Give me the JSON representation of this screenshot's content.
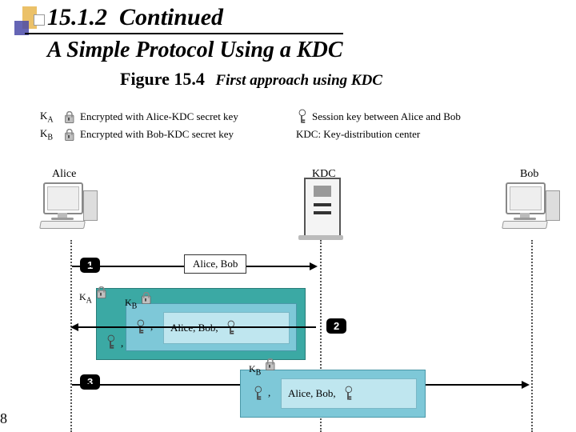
{
  "header": {
    "section_no": "15.1.2",
    "cont": "Continued",
    "subtitle": "A Simple Protocol Using a KDC"
  },
  "figure": {
    "num": "Figure 15.4",
    "title": "First approach using KDC"
  },
  "legend": {
    "ka_sym": "K",
    "ka_sub": "A",
    "ka_text": "Encrypted with Alice-KDC secret key",
    "kb_sym": "K",
    "kb_sub": "B",
    "kb_text": "Encrypted with Bob-KDC secret key",
    "skey_text": "Session key between Alice and Bob",
    "kdc_text": "KDC: Key-distribution center"
  },
  "actors": {
    "alice": "Alice",
    "kdc": "KDC",
    "bob": "Bob"
  },
  "steps": {
    "s1": "1",
    "s2": "2",
    "s3": "3"
  },
  "msgs": {
    "m1": "Alice, Bob",
    "nested": "Alice, Bob,",
    "ka_label": "K",
    "ka_label_sub": "A",
    "kb_label": "K",
    "kb_label_sub": "B"
  },
  "page": "8"
}
